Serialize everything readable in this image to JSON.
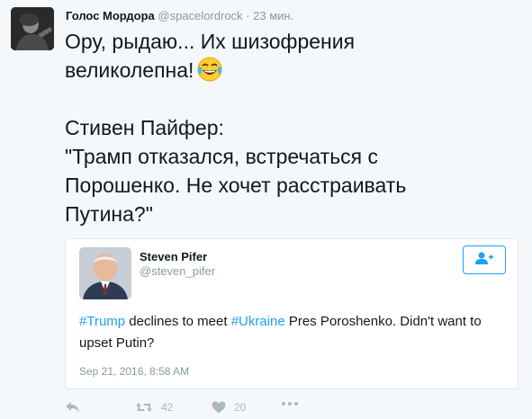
{
  "tweet": {
    "author_name": "Голос Мордора",
    "author_handle": "@spacelordrock",
    "separator": "·",
    "time": "23 мин.",
    "text_line1": "Ору, рыдаю... Их шизофрения",
    "text_line2": "великолепна!",
    "text_rest": "Стивен Пайфер:\n\"Трамп отказался, встречаться с\nПорошенко. Не хочет расстраивать\nПутина?\"",
    "emoji_icon": "face-with-tears-of-joy-icon"
  },
  "quoted_tweet": {
    "author_name": "Steven Pifer",
    "author_handle": "@steven_pifer",
    "hashtag1": "#Trump",
    "text_part1": " declines to meet ",
    "hashtag2": "#Ukraine",
    "text_part2": " Pres Poroshenko. Didn't want to upset Putin?",
    "date": "Sep 21, 2016, 8:58 AM",
    "follow_icon": "follow-user-icon"
  },
  "actions": {
    "retweet_count": "42",
    "like_count": "20"
  },
  "colors": {
    "accent": "#1da1f2",
    "muted": "#8899a6",
    "background": "#f5f8fa"
  }
}
